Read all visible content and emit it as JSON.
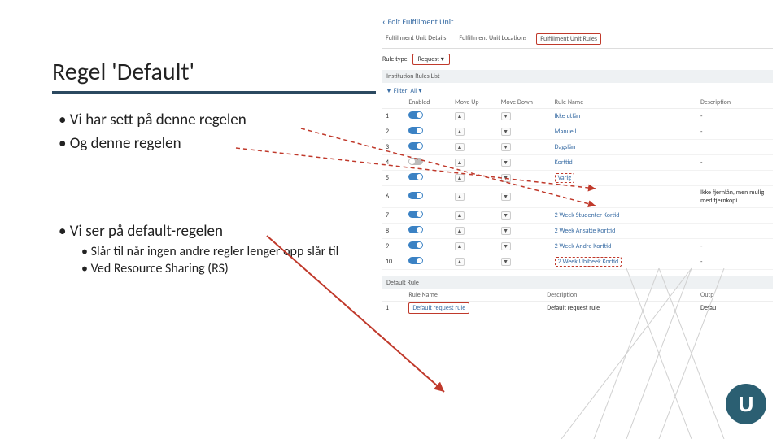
{
  "title": "Regel 'Default'",
  "bulletsTop": {
    "b1": "Vi har sett på denne regelen",
    "b2": "Og denne regelen"
  },
  "bulletsBottom": {
    "b3": "Vi ser på default-regelen",
    "sub1": "Slår til når ingen andre regler lenger opp slår til",
    "sub2": "Ved Resource Sharing (RS)"
  },
  "screenshot": {
    "backLabel": "Edit Fulfillment Unit",
    "tabs": {
      "t1": "Fulfillment Unit Details",
      "t2": "Fulfillment Unit Locations",
      "t3": "Fulfillment Unit Rules"
    },
    "ruleTypeLabel": "Rule type",
    "ruleTypeValue": "Request",
    "listHeader": "Institution Rules List",
    "filterLabel": "Filter: All",
    "cols": {
      "enabled": "Enabled",
      "up": "Move Up",
      "down": "Move Down",
      "name": "Rule Name",
      "desc": "Description"
    },
    "rows": [
      {
        "n": "1",
        "name": "Ikke utlån",
        "desc": "-",
        "en": true,
        "hl": false
      },
      {
        "n": "2",
        "name": "Manuell",
        "desc": "-",
        "en": true,
        "hl": false
      },
      {
        "n": "3",
        "name": "Dagslån",
        "desc": "",
        "en": true,
        "hl": false
      },
      {
        "n": "4",
        "name": "Korttid",
        "desc": "-",
        "en": false,
        "hl": false
      },
      {
        "n": "5",
        "name": "Varig",
        "desc": "",
        "en": true,
        "hl": true
      },
      {
        "n": "6",
        "name": "",
        "desc": "Ikke fjernlån, men mulig med fjernkopi",
        "en": true,
        "hl": false
      },
      {
        "n": "7",
        "name": "2 Week Studenter Kortid",
        "desc": "",
        "en": true,
        "hl": false
      },
      {
        "n": "8",
        "name": "2 Week Ansatte Korttid",
        "desc": "",
        "en": true,
        "hl": false
      },
      {
        "n": "9",
        "name": "2 Week Andre Korttid",
        "desc": "-",
        "en": true,
        "hl": false
      },
      {
        "n": "10",
        "name": "2 Week Ubibeek Kortid",
        "desc": "-",
        "en": true,
        "hl": true
      }
    ],
    "defaultHeader": "Default Rule",
    "defCols": {
      "name": "Rule Name",
      "desc": "Description",
      "out": "Outp"
    },
    "defRow": {
      "n": "1",
      "name": "Default request rule",
      "desc": "Default request rule",
      "out": "Defau"
    }
  },
  "logo": "U"
}
